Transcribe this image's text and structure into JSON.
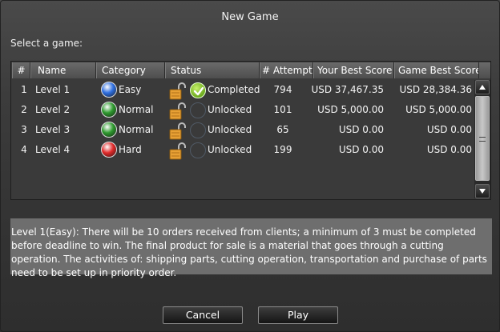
{
  "window": {
    "title": "New Game"
  },
  "select_label": "Select a game:",
  "table": {
    "columns": [
      "#",
      "Name",
      "Category",
      "Status",
      "# Attempts",
      "Your Best Score",
      "Game Best Score"
    ],
    "rows": [
      {
        "num": "1",
        "name": "Level 1",
        "category": "Easy",
        "category_color": "#2f6fe0",
        "status": "Completed",
        "completed": true,
        "attempts": "794",
        "best": "USD 37,467.35",
        "game_best": "USD 28,384.36"
      },
      {
        "num": "2",
        "name": "Level 2",
        "category": "Normal",
        "category_color": "#2e9a2e",
        "status": "Unlocked",
        "completed": false,
        "attempts": "101",
        "best": "USD 5,000.00",
        "game_best": "USD 5,000.00"
      },
      {
        "num": "3",
        "name": "Level 3",
        "category": "Normal",
        "category_color": "#2e9a2e",
        "status": "Unlocked",
        "completed": false,
        "attempts": "65",
        "best": "USD 0.00",
        "game_best": "USD 0.00"
      },
      {
        "num": "4",
        "name": "Level 4",
        "category": "Hard",
        "category_color": "#e02a2a",
        "status": "Unlocked",
        "completed": false,
        "attempts": "199",
        "best": "USD 0.00",
        "game_best": "USD 0.00"
      }
    ]
  },
  "icons": {
    "status_lock": "open-padlock-icon",
    "status_check": "checkmark-icon",
    "scroll_up": "arrow-up-icon",
    "scroll_down": "arrow-down-icon",
    "scroll_grip": "grip-icon"
  },
  "description": "Level 1(Easy): There will be 10 orders received from clients; a minimum of 3 must be completed before deadline to win. The final product for sale is a material that goes through a cutting operation. The activities of: shipping parts, cutting operation, transportation and purchase of parts need to be set up in priority order.",
  "buttons": {
    "cancel": "Cancel",
    "play": "Play"
  }
}
